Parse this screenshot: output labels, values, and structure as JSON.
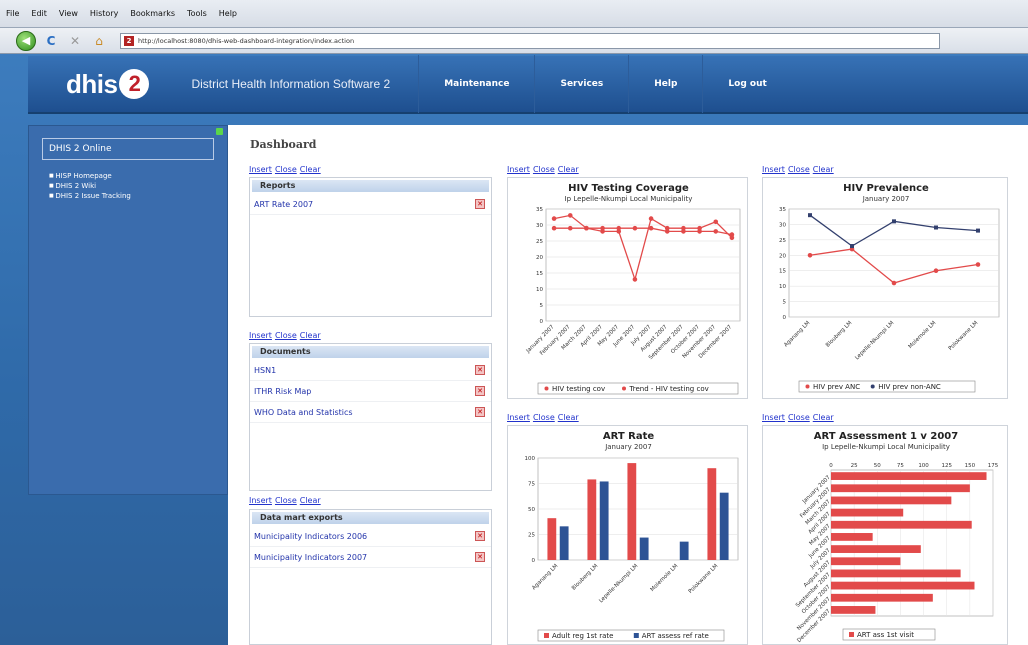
{
  "browser": {
    "menu": [
      "File",
      "Edit",
      "View",
      "History",
      "Bookmarks",
      "Tools",
      "Help"
    ],
    "url": "http://localhost:8080/dhis-web-dashboard-integration/index.action",
    "back_glyph": "◀",
    "reload_glyph": "C",
    "stop_glyph": "✕",
    "home_glyph": "⌂"
  },
  "header": {
    "logo_text": "dhis",
    "logo_num": "2",
    "app_title": "District Health Information Software 2",
    "nav": [
      "Maintenance",
      "Services",
      "Help",
      "Log out"
    ]
  },
  "sidebar": {
    "title": "DHIS 2 Online",
    "links": [
      "HISP Homepage",
      "DHIS 2 Wiki",
      "DHIS 2 Issue Tracking"
    ]
  },
  "dashboard": {
    "title": "Dashboard",
    "link_labels": {
      "insert": "Insert",
      "close": "Close",
      "clear": "Clear"
    },
    "reports": {
      "header": "Reports",
      "items": [
        "ART Rate 2007"
      ]
    },
    "documents": {
      "header": "Documents",
      "items": [
        "HSN1",
        "ITHR Risk Map",
        "WHO Data and Statistics"
      ]
    },
    "datamart": {
      "header": "Data mart exports",
      "items": [
        "Municipality Indicators 2006",
        "Municipality Indicators 2007"
      ]
    }
  },
  "chart_data": [
    {
      "type": "line",
      "title": "HIV Testing Coverage",
      "subtitle": "Ip Lepelle-Nkumpi Local Municipality",
      "ylim": [
        0,
        35
      ],
      "yticks": [
        0,
        5,
        10,
        15,
        20,
        25,
        30,
        35
      ],
      "categories": [
        "January 2007",
        "February 2007",
        "March 2007",
        "April 2007",
        "May 2007",
        "June 2007",
        "July 2007",
        "August 2007",
        "September 2007",
        "October 2007",
        "November 2007",
        "December 2007"
      ],
      "series": [
        {
          "name": "HIV testing cov",
          "values": [
            32,
            33,
            29,
            28,
            28,
            13,
            32,
            29,
            29,
            29,
            31,
            26
          ],
          "color": "#e24a4a"
        },
        {
          "name": "Trend - HIV testing cov",
          "values": [
            29,
            29,
            29,
            29,
            29,
            29,
            29,
            28,
            28,
            28,
            28,
            27
          ],
          "color": "#e24a4a"
        }
      ]
    },
    {
      "type": "line",
      "title": "HIV Prevalence",
      "subtitle": "January 2007",
      "ylim": [
        0,
        35
      ],
      "yticks": [
        0,
        5,
        10,
        15,
        20,
        25,
        30,
        35
      ],
      "categories": [
        "Aganang LM",
        "Blouberg LM",
        "Lepelle-Nkumpi LM",
        "Molemole LM",
        "Polokwane LM"
      ],
      "series": [
        {
          "name": "HIV prev ANC",
          "values": [
            20,
            22,
            11,
            15,
            17
          ],
          "color": "#e24a4a"
        },
        {
          "name": "HIV prev non-ANC",
          "values": [
            33,
            23,
            31,
            29,
            28
          ],
          "color": "#33406e"
        }
      ]
    },
    {
      "type": "bar",
      "title": "ART Rate",
      "subtitle": "January 2007",
      "ylim": [
        0,
        100
      ],
      "yticks": [
        0,
        25,
        50,
        75,
        100
      ],
      "categories": [
        "Aganang LM",
        "Blouberg LM",
        "Lepelle-Nkumpi LM",
        "Molemole LM",
        "Polokwane LM"
      ],
      "series": [
        {
          "name": "Adult reg 1st rate",
          "values": [
            41,
            79,
            95,
            0,
            90
          ],
          "color": "#e24a4a"
        },
        {
          "name": "ART assess ref rate",
          "values": [
            33,
            77,
            22,
            18,
            66
          ],
          "color": "#2d5395"
        }
      ]
    },
    {
      "type": "bar",
      "orientation": "horizontal",
      "title": "ART Assessment 1 v 2007",
      "subtitle": "Ip Lepelle-Nkumpi Local Municipality",
      "xlim": [
        0,
        175
      ],
      "xticks": [
        0,
        25,
        50,
        75,
        100,
        125,
        150,
        175
      ],
      "categories": [
        "January 2007",
        "February 2007",
        "March 2007",
        "April 2007",
        "May 2007",
        "June 2007",
        "July 2007",
        "August 2007",
        "September 2007",
        "October 2007",
        "November 2007",
        "December 2007"
      ],
      "series": [
        {
          "name": "ART ass 1st visit",
          "values": [
            168,
            150,
            130,
            78,
            152,
            45,
            97,
            75,
            140,
            155,
            110,
            48
          ],
          "color": "#e24a4a"
        }
      ]
    }
  ]
}
